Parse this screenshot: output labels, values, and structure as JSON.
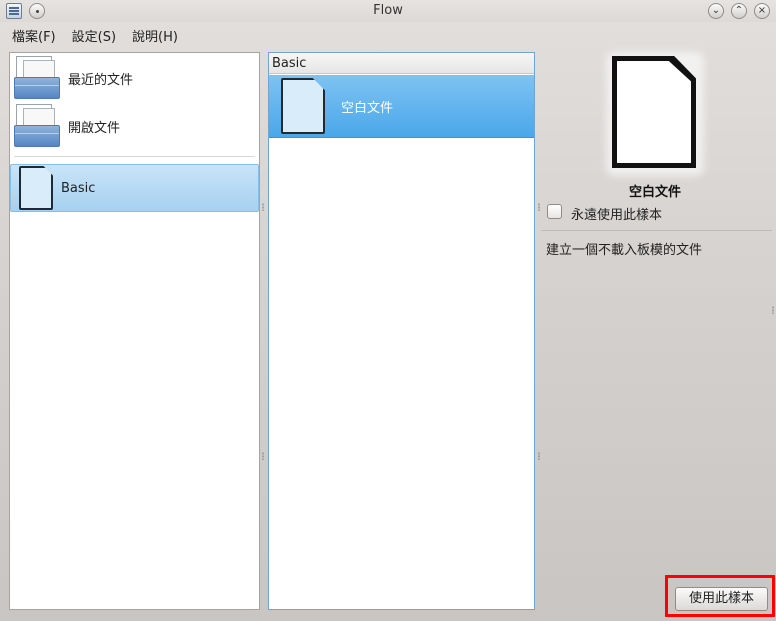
{
  "window": {
    "title": "Flow"
  },
  "menu": [
    {
      "label": "檔案(F)"
    },
    {
      "label": "設定(S)"
    },
    {
      "label": "說明(H)"
    }
  ],
  "left_panel": {
    "items": [
      {
        "label": "最近的文件",
        "icon": "recent-documents-icon"
      },
      {
        "label": "開啟文件",
        "icon": "open-document-icon"
      },
      {
        "label": "Basic",
        "icon": "blank-document-icon",
        "selected": true
      }
    ]
  },
  "middle_panel": {
    "header": "Basic",
    "items": [
      {
        "label": "空白文件",
        "icon": "blank-document-icon",
        "selected": true
      }
    ]
  },
  "preview": {
    "name": "空白文件",
    "always_use_label": "永遠使用此樣本",
    "always_use_checked": false,
    "description": "建立一個不載入板模的文件"
  },
  "actions": {
    "use_template_label": "使用此樣本"
  }
}
